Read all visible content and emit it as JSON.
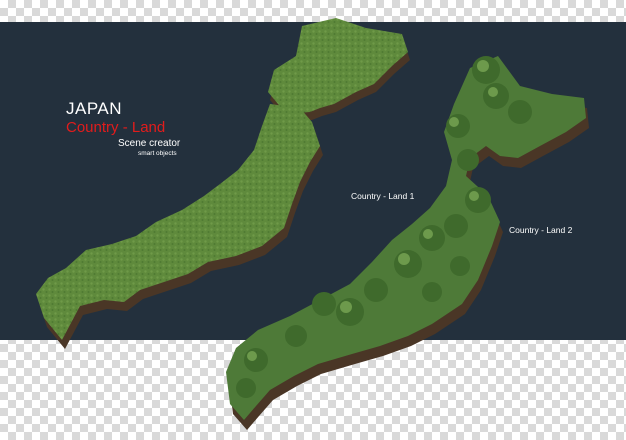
{
  "heading": {
    "title": "JAPAN",
    "subtitle": "Country - Land",
    "creator": "Scene creator",
    "smart": "smart objects"
  },
  "labels": {
    "land1": "Country - Land 1",
    "land2": "Country - Land 2"
  },
  "colors": {
    "panel": "#23303d",
    "accent": "#e21c1c",
    "grass": "#5f8a3c",
    "trees": "#4e7a38",
    "soil": "#4a3626"
  }
}
